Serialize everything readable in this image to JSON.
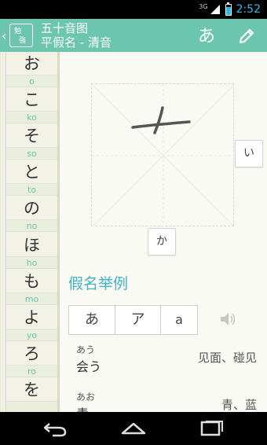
{
  "status_bar": {
    "network": "3G",
    "time": "2:52",
    "battery_level": 0.75,
    "icons": [
      "signal-icon",
      "battery-icon"
    ]
  },
  "action_bar": {
    "back_glyph": "‹",
    "logo_chars": [
      "勉",
      "強"
    ],
    "title": "五十音图",
    "subtitle": "平假名 - 清音",
    "kana_button": "あ",
    "edit_icon": "pencil-icon",
    "color": "#6bc6ad"
  },
  "kana_list": [
    {
      "kana": "お",
      "romaji": "o"
    },
    {
      "kana": "こ",
      "romaji": "ko"
    },
    {
      "kana": "そ",
      "romaji": "so"
    },
    {
      "kana": "と",
      "romaji": "to"
    },
    {
      "kana": "の",
      "romaji": "no"
    },
    {
      "kana": "ほ",
      "romaji": "ho"
    },
    {
      "kana": "も",
      "romaji": "mo"
    },
    {
      "kana": "よ",
      "romaji": "yo"
    },
    {
      "kana": "ろ",
      "romaji": "ro"
    },
    {
      "kana": "を",
      "romaji": ""
    }
  ],
  "canvas": {
    "next_button": "い",
    "bottom_button": "か"
  },
  "examples_section": {
    "title": "假名举例",
    "tabs": [
      "あ",
      "ア",
      "a"
    ],
    "speaker_icon": "speaker-icon",
    "accent": "#3fb3c8",
    "items": [
      {
        "reading": "あう",
        "word": "会う",
        "meaning": "见面、碰见"
      },
      {
        "reading": "あお",
        "word": "青",
        "meaning": "青、蓝"
      }
    ]
  },
  "nav_bar": {
    "icons": [
      "back-icon",
      "home-icon",
      "recent-apps-icon"
    ]
  }
}
